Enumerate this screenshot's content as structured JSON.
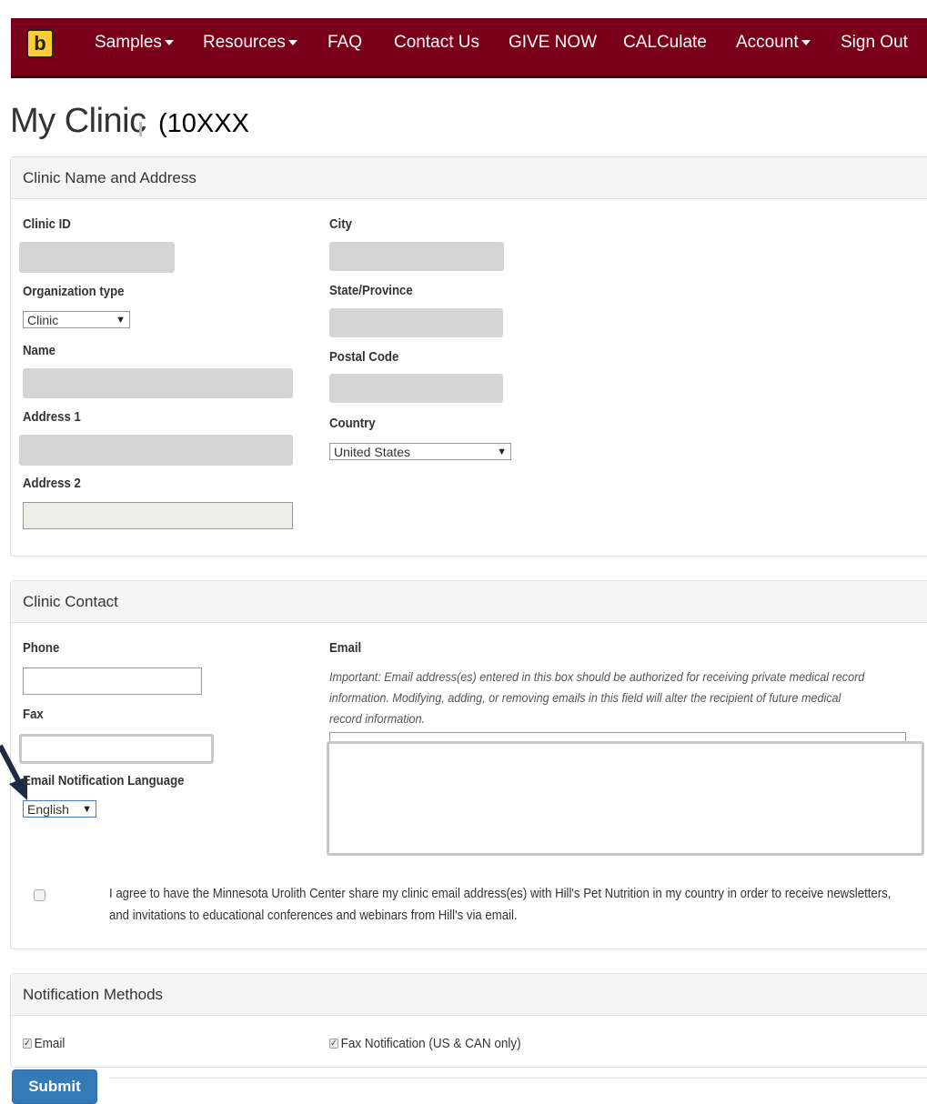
{
  "nav": {
    "logo_letter": "b",
    "items": [
      {
        "label": "Samples",
        "dropdown": true
      },
      {
        "label": "Resources",
        "dropdown": true
      },
      {
        "label": "FAQ",
        "dropdown": false
      },
      {
        "label": "Contact Us",
        "dropdown": false
      },
      {
        "label": "GIVE NOW",
        "dropdown": false
      },
      {
        "label": "CALCulate",
        "dropdown": false
      },
      {
        "label": "Account",
        "dropdown": true
      },
      {
        "label": "Sign Out",
        "dropdown": false
      }
    ],
    "bg_color": "#7a0019"
  },
  "page": {
    "title": "My Clinic",
    "title_suffix": "(10XXX"
  },
  "clinic_address": {
    "heading": "Clinic Name and Address",
    "clinic_id_label": "Clinic ID",
    "org_type_label": "Organization type",
    "org_type_value": "Clinic",
    "name_label": "Name",
    "address1_label": "Address 1",
    "address2_label": "Address 2",
    "city_label": "City",
    "state_label": "State/Province",
    "postal_label": "Postal Code",
    "country_label": "Country",
    "country_value": "United States"
  },
  "clinic_contact": {
    "heading": "Clinic Contact",
    "phone_label": "Phone",
    "fax_label": "Fax",
    "email_lang_label": "Email Notification Language",
    "email_lang_value": "English",
    "email_label": "Email",
    "email_note": "Important: Email address(es) entered in this box should be authorized for receiving private medical record information. Modifying, adding, or removing emails in this field will alter the recipient of future medical record information.",
    "agree_text": "I agree to have the Minnesota Urolith Center share my clinic email address(es) with Hill's Pet Nutrition in my country in order to receive newsletters, and invitations to educational conferences and webinars from Hill's via email."
  },
  "notification": {
    "heading": "Notification Methods",
    "email_label": "Email",
    "fax_label": "Fax Notification (US & CAN only)"
  },
  "submit_label": "Submit"
}
